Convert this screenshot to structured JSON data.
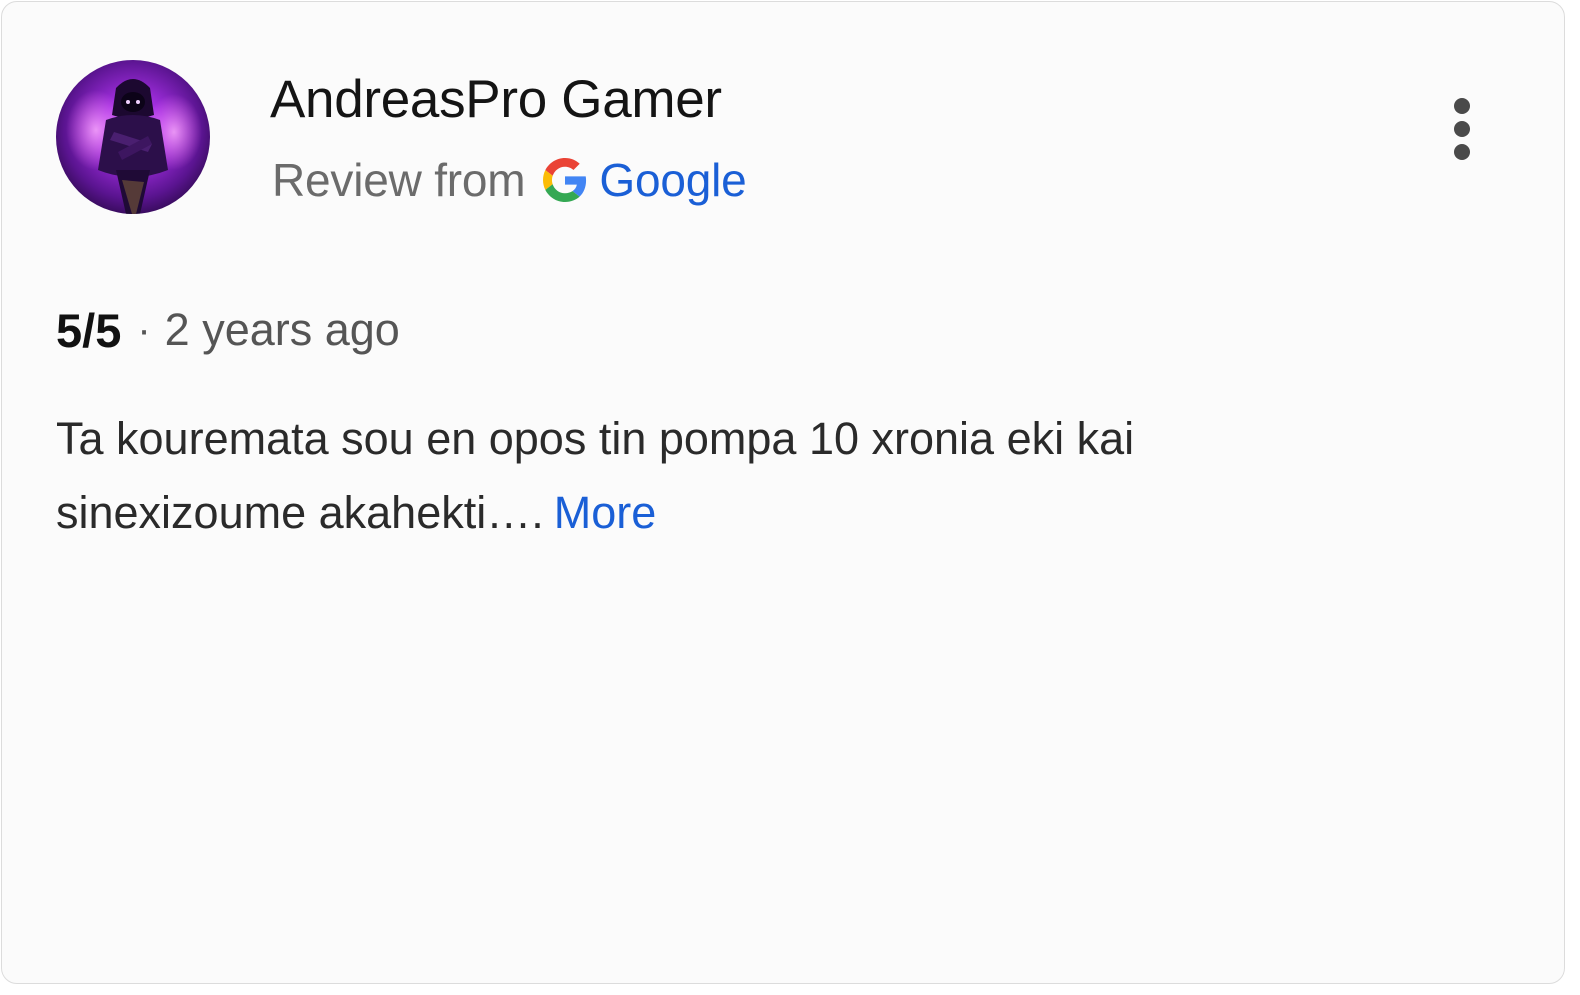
{
  "review": {
    "reviewer_name": "AndreasPro Gamer",
    "source_prefix": "Review from",
    "source_name": "Google",
    "rating": "5/5",
    "separator": "·",
    "age": "2 years ago",
    "text_line_1": "Ta kouremata sou en opos tin pompa 10 xronia eki kai",
    "text_line_2": "sinexizoume akahekti….",
    "more_label": "More"
  },
  "icons": {
    "avatar": "hooded-character-avatar",
    "source": "google-g-icon",
    "menu": "more-options-icon"
  },
  "colors": {
    "link": "#1a5fd6",
    "name": "#141414",
    "muted": "#6b6b6b",
    "avatar_glow": "#b43cf0"
  }
}
